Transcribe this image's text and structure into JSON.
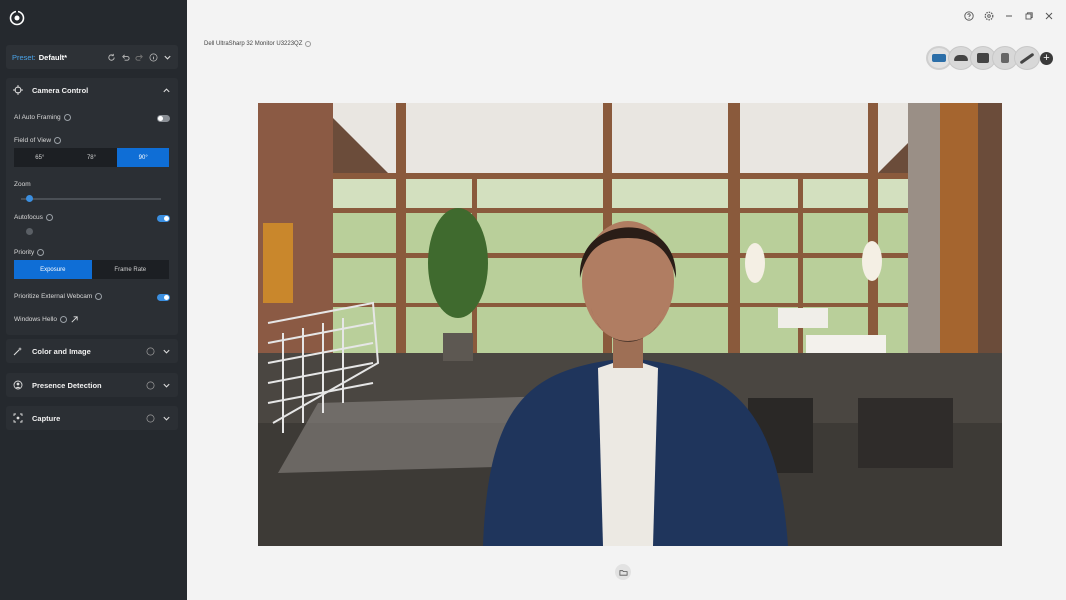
{
  "preset": {
    "label": "Preset:",
    "value": "Default*"
  },
  "camera_control": {
    "title": "Camera Control",
    "ai_auto_framing": {
      "label": "AI Auto Framing",
      "on": false
    },
    "field_of_view": {
      "label": "Field of View",
      "options": [
        "65°",
        "78°",
        "90°"
      ],
      "selected": "90°"
    },
    "zoom": {
      "label": "Zoom",
      "level": 0.0
    },
    "autofocus": {
      "label": "Autofocus",
      "on": true
    },
    "priority": {
      "label": "Priority",
      "options": [
        "Exposure",
        "Frame Rate"
      ],
      "selected": "Exposure"
    },
    "prioritize_external": {
      "label": "Prioritize External Webcam",
      "on": true
    },
    "windows_hello": {
      "label": "Windows Hello"
    }
  },
  "sections": {
    "color_image": "Color and Image",
    "presence": "Presence Detection",
    "capture": "Capture"
  },
  "device": {
    "title": "Dell UltraSharp 32 Monitor U3223QZ"
  },
  "icons": [
    "app-logo-icon",
    "help-icon",
    "settings-icon",
    "minimize-icon",
    "restore-icon",
    "close-icon",
    "folder-icon",
    "add-icon"
  ],
  "colors": {
    "accent": "#0f6ed6",
    "sidebar": "#25292e",
    "background": "#f3f3f3"
  }
}
